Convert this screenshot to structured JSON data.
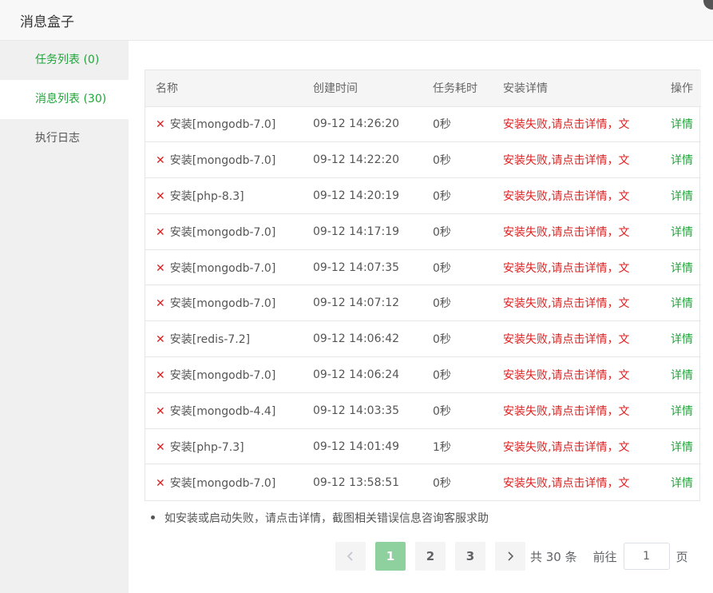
{
  "window": {
    "title": "消息盒子"
  },
  "sidebar": {
    "items": [
      {
        "label": "任务列表 (0)"
      },
      {
        "label": "消息列表 (30)"
      },
      {
        "label": "执行日志"
      }
    ]
  },
  "table": {
    "headers": [
      "名称",
      "创建时间",
      "任务耗时",
      "安装详情",
      "操作"
    ],
    "rows": [
      {
        "name": "安装[mongodb-7.0]",
        "time": "09-12 14:26:20",
        "duration": "0秒",
        "detail": "安装失败,请点击详情，文",
        "action": "详情"
      },
      {
        "name": "安装[mongodb-7.0]",
        "time": "09-12 14:22:20",
        "duration": "0秒",
        "detail": "安装失败,请点击详情，文",
        "action": "详情"
      },
      {
        "name": "安装[php-8.3]",
        "time": "09-12 14:20:19",
        "duration": "0秒",
        "detail": "安装失败,请点击详情，文",
        "action": "详情"
      },
      {
        "name": "安装[mongodb-7.0]",
        "time": "09-12 14:17:19",
        "duration": "0秒",
        "detail": "安装失败,请点击详情，文",
        "action": "详情"
      },
      {
        "name": "安装[mongodb-7.0]",
        "time": "09-12 14:07:35",
        "duration": "0秒",
        "detail": "安装失败,请点击详情，文",
        "action": "详情"
      },
      {
        "name": "安装[mongodb-7.0]",
        "time": "09-12 14:07:12",
        "duration": "0秒",
        "detail": "安装失败,请点击详情，文",
        "action": "详情"
      },
      {
        "name": "安装[redis-7.2]",
        "time": "09-12 14:06:42",
        "duration": "0秒",
        "detail": "安装失败,请点击详情，文",
        "action": "详情"
      },
      {
        "name": "安装[mongodb-7.0]",
        "time": "09-12 14:06:24",
        "duration": "0秒",
        "detail": "安装失败,请点击详情，文",
        "action": "详情"
      },
      {
        "name": "安装[mongodb-4.4]",
        "time": "09-12 14:03:35",
        "duration": "0秒",
        "detail": "安装失败,请点击详情，文",
        "action": "详情"
      },
      {
        "name": "安装[php-7.3]",
        "time": "09-12 14:01:49",
        "duration": "1秒",
        "detail": "安装失败,请点击详情，文",
        "action": "详情"
      },
      {
        "name": "安装[mongodb-7.0]",
        "time": "09-12 13:58:51",
        "duration": "0秒",
        "detail": "安装失败,请点击详情，文",
        "action": "详情"
      }
    ]
  },
  "note": "如安装或启动失败，请点击详情，截图相关错误信息咨询客服求助",
  "pagination": {
    "prev_icon": "chevron-left-icon",
    "next_icon": "chevron-right-icon",
    "pages": [
      "1",
      "2",
      "3"
    ],
    "current": "1",
    "total_text": "共 30 条",
    "goto_label": "前往",
    "goto_value": "1",
    "goto_suffix": "页"
  },
  "colors": {
    "accent": "#20a53a",
    "error": "#e02020",
    "active_page": "#8fd19e"
  }
}
